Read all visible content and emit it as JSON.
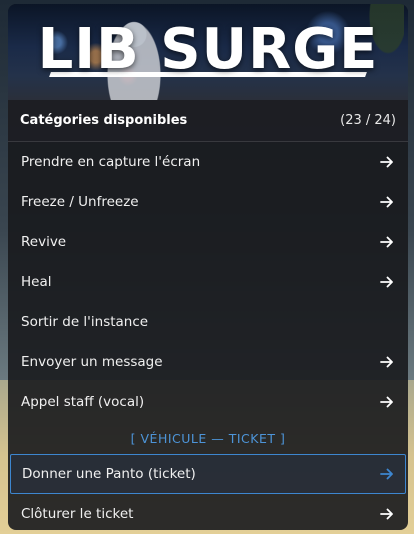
{
  "banner": {
    "title": "LIB SURGE"
  },
  "header": {
    "title": "Catégories disponibles",
    "count": "(23 / 24)"
  },
  "items": [
    {
      "label": "Prendre en capture l'écran",
      "arrow": true
    },
    {
      "label": "Freeze / Unfreeze",
      "arrow": true
    },
    {
      "label": "Revive",
      "arrow": true
    },
    {
      "label": "Heal",
      "arrow": true
    },
    {
      "label": "Sortir de l'instance",
      "arrow": false
    },
    {
      "label": "Envoyer un message",
      "arrow": true
    },
    {
      "label": "Appel staff (vocal)",
      "arrow": true
    }
  ],
  "section": {
    "label": "[ VÉHICULE — TICKET ]"
  },
  "section_items": [
    {
      "label": "Donner une Panto (ticket)",
      "arrow": true,
      "selected": true
    },
    {
      "label": "Clôturer le ticket",
      "arrow": true,
      "selected": false
    }
  ],
  "colors": {
    "accent": "#3d86cf",
    "section_text": "#4d94d8",
    "panel": "#18191d"
  },
  "icons": {
    "item_arrow": "arrow-right-icon"
  }
}
